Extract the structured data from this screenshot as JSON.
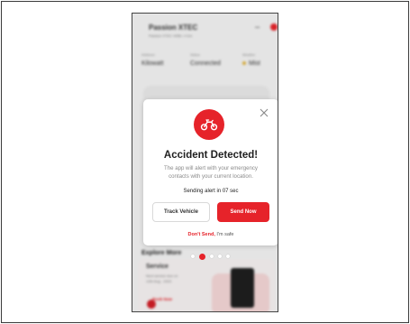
{
  "colors": {
    "accent": "#e6232a",
    "text_dark": "#1f1f1f",
    "text_muted": "#8a8a8a"
  },
  "background_app": {
    "title": "Passion XTEC",
    "subtitle": "Passion XTEC 4958 • 4 km",
    "more": "•••",
    "stats": [
      {
        "caption": "Distance",
        "value": "Kilowatt"
      },
      {
        "caption": "Status",
        "value": "Connected"
      },
      {
        "caption": "Weather",
        "value": "Mist"
      }
    ],
    "section_title": "Explore More",
    "service": {
      "title": "Service",
      "line1": "Next service due on",
      "line2": "12th Aug - 2023",
      "link": "Book Now"
    }
  },
  "modal": {
    "icon": "motorcycle-icon",
    "title": "Accident Detected!",
    "description": "The app will alert with your emergency contacts with your current location.",
    "countdown": "Sending alert in 07 sec",
    "track_button": "Track Vehicle",
    "send_button": "Send Now",
    "dont_send_link": "Don't Send,",
    "dont_send_suffix": " I'm safe"
  },
  "pager": {
    "total": 5,
    "active_index": 1
  }
}
